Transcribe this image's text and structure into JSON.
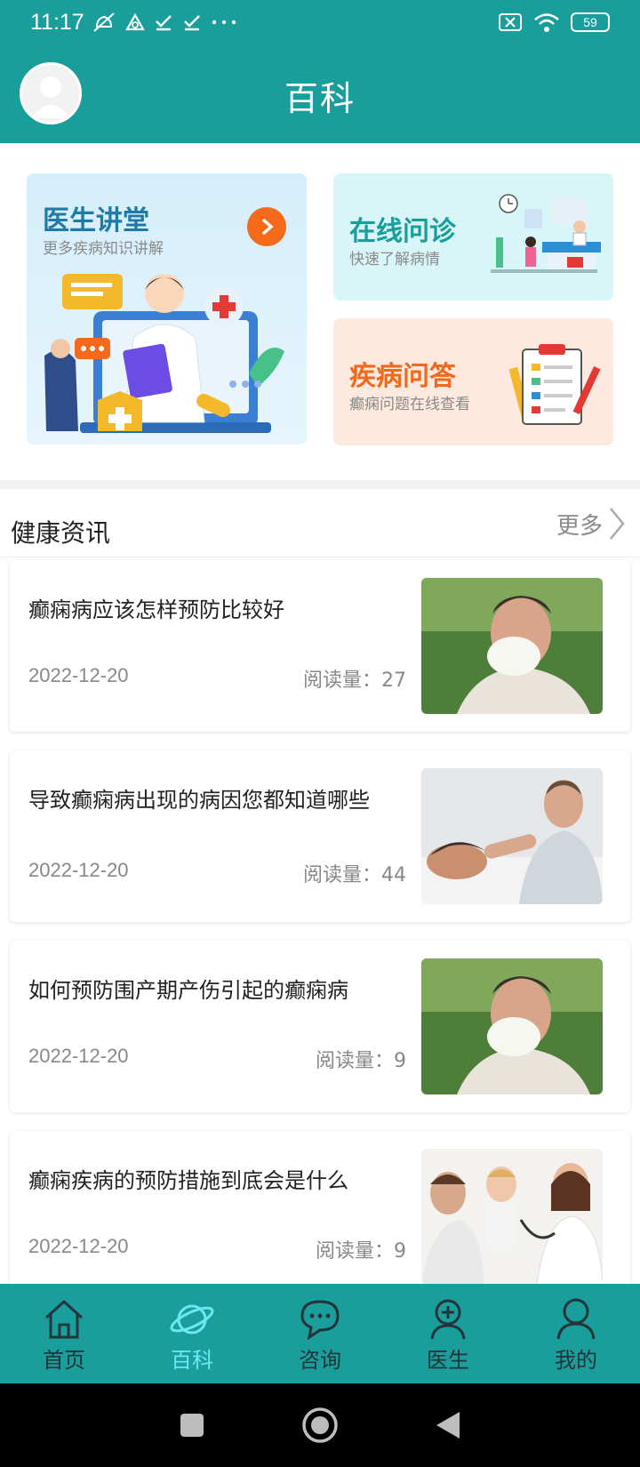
{
  "status_bar": {
    "time": "11:17",
    "battery": "59"
  },
  "header": {
    "title": "百科"
  },
  "features": {
    "lecture": {
      "title": "医生讲堂",
      "subtitle": "更多疾病知识讲解"
    },
    "online": {
      "title": "在线问诊",
      "subtitle": "快速了解病情"
    },
    "qa": {
      "title": "疾病问答",
      "subtitle": "癫痫问题在线查看"
    }
  },
  "section": {
    "title": "健康资讯",
    "more": "更多"
  },
  "news": [
    {
      "title": "癫痫病应该怎样预防比较好",
      "date": "2022-12-20",
      "reads": "阅读量：27"
    },
    {
      "title": "导致癫痫病出现的病因您都知道哪些",
      "date": "2022-12-20",
      "reads": "阅读量：44"
    },
    {
      "title": "如何预防围产期产伤引起的癫痫病",
      "date": "2022-12-20",
      "reads": "阅读量：9"
    },
    {
      "title": "癫痫疾病的预防措施到底会是什么",
      "date": "2022-12-20",
      "reads": "阅读量：9"
    }
  ],
  "tabs": [
    {
      "label": "首页",
      "icon": "home-icon"
    },
    {
      "label": "百科",
      "icon": "planet-icon",
      "active": true
    },
    {
      "label": "咨询",
      "icon": "chat-icon"
    },
    {
      "label": "医生",
      "icon": "doctor-icon"
    },
    {
      "label": "我的",
      "icon": "user-icon"
    }
  ],
  "colors": {
    "primary": "#1a9e9b",
    "active_tab": "#6ee8f0",
    "accent_orange": "#f56a1a"
  }
}
